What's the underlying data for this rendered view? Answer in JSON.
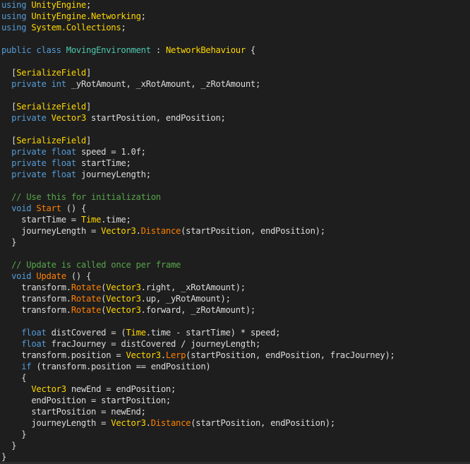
{
  "editor": {
    "theme_colors": {
      "background": "#1e1e1e",
      "keyword": "#569cd6",
      "class_name": "#4ec9b0",
      "unity_type": "#ffd700",
      "method": "#ff8000",
      "comment": "#57a64a",
      "identifier": "#dcdcdc"
    },
    "lines": [
      [
        {
          "t": "kw",
          "v": "using"
        },
        {
          "t": "id",
          "v": " "
        },
        {
          "t": "uy",
          "v": "UnityEngine"
        },
        {
          "t": "id",
          "v": ";"
        }
      ],
      [
        {
          "t": "kw",
          "v": "using"
        },
        {
          "t": "id",
          "v": " "
        },
        {
          "t": "uy",
          "v": "UnityEngine.Networking"
        },
        {
          "t": "id",
          "v": ";"
        }
      ],
      [
        {
          "t": "kw",
          "v": "using"
        },
        {
          "t": "id",
          "v": " "
        },
        {
          "t": "uy",
          "v": "System.Collections"
        },
        {
          "t": "id",
          "v": ";"
        }
      ],
      [],
      [
        {
          "t": "kw",
          "v": "public"
        },
        {
          "t": "id",
          "v": " "
        },
        {
          "t": "kw",
          "v": "class"
        },
        {
          "t": "id",
          "v": " "
        },
        {
          "t": "ty",
          "v": "MovingEnvironment"
        },
        {
          "t": "id",
          "v": " : "
        },
        {
          "t": "uy",
          "v": "NetworkBehaviour"
        },
        {
          "t": "id",
          "v": " {"
        }
      ],
      [],
      [
        {
          "t": "id",
          "v": "  ["
        },
        {
          "t": "uy",
          "v": "SerializeField"
        },
        {
          "t": "id",
          "v": "]"
        }
      ],
      [
        {
          "t": "id",
          "v": "  "
        },
        {
          "t": "kw",
          "v": "private"
        },
        {
          "t": "id",
          "v": " "
        },
        {
          "t": "kw",
          "v": "int"
        },
        {
          "t": "id",
          "v": " _yRotAmount, _xRotAmount, _zRotAmount;"
        }
      ],
      [],
      [
        {
          "t": "id",
          "v": "  ["
        },
        {
          "t": "uy",
          "v": "SerializeField"
        },
        {
          "t": "id",
          "v": "]"
        }
      ],
      [
        {
          "t": "id",
          "v": "  "
        },
        {
          "t": "kw",
          "v": "private"
        },
        {
          "t": "id",
          "v": " "
        },
        {
          "t": "uy",
          "v": "Vector3"
        },
        {
          "t": "id",
          "v": " startPosition, endPosition;"
        }
      ],
      [],
      [
        {
          "t": "id",
          "v": "  ["
        },
        {
          "t": "uy",
          "v": "SerializeField"
        },
        {
          "t": "id",
          "v": "]"
        }
      ],
      [
        {
          "t": "id",
          "v": "  "
        },
        {
          "t": "kw",
          "v": "private"
        },
        {
          "t": "id",
          "v": " "
        },
        {
          "t": "kw",
          "v": "float"
        },
        {
          "t": "id",
          "v": " speed = 1.0f;"
        }
      ],
      [
        {
          "t": "id",
          "v": "  "
        },
        {
          "t": "kw",
          "v": "private"
        },
        {
          "t": "id",
          "v": " "
        },
        {
          "t": "kw",
          "v": "float"
        },
        {
          "t": "id",
          "v": " startTime;"
        }
      ],
      [
        {
          "t": "id",
          "v": "  "
        },
        {
          "t": "kw",
          "v": "private"
        },
        {
          "t": "id",
          "v": " "
        },
        {
          "t": "kw",
          "v": "float"
        },
        {
          "t": "id",
          "v": " journeyLength;"
        }
      ],
      [],
      [
        {
          "t": "id",
          "v": "  "
        },
        {
          "t": "cm",
          "v": "// Use this for initialization"
        }
      ],
      [
        {
          "t": "id",
          "v": "  "
        },
        {
          "t": "kw",
          "v": "void"
        },
        {
          "t": "id",
          "v": " "
        },
        {
          "t": "fn",
          "v": "Start"
        },
        {
          "t": "id",
          "v": " () {"
        }
      ],
      [
        {
          "t": "id",
          "v": "    startTime = "
        },
        {
          "t": "uy",
          "v": "Time"
        },
        {
          "t": "id",
          "v": ".time;"
        }
      ],
      [
        {
          "t": "id",
          "v": "    journeyLength = "
        },
        {
          "t": "uy",
          "v": "Vector3"
        },
        {
          "t": "id",
          "v": "."
        },
        {
          "t": "fn",
          "v": "Distance"
        },
        {
          "t": "id",
          "v": "(startPosition, endPosition);"
        }
      ],
      [
        {
          "t": "id",
          "v": "  }"
        }
      ],
      [],
      [
        {
          "t": "id",
          "v": "  "
        },
        {
          "t": "cm",
          "v": "// Update is called once per frame"
        }
      ],
      [
        {
          "t": "id",
          "v": "  "
        },
        {
          "t": "kw",
          "v": "void"
        },
        {
          "t": "id",
          "v": " "
        },
        {
          "t": "fn",
          "v": "Update"
        },
        {
          "t": "id",
          "v": " () {"
        }
      ],
      [
        {
          "t": "id",
          "v": "    transform."
        },
        {
          "t": "fn",
          "v": "Rotate"
        },
        {
          "t": "id",
          "v": "("
        },
        {
          "t": "uy",
          "v": "Vector3"
        },
        {
          "t": "id",
          "v": ".right, _xRotAmount);"
        }
      ],
      [
        {
          "t": "id",
          "v": "    transform."
        },
        {
          "t": "fn",
          "v": "Rotate"
        },
        {
          "t": "id",
          "v": "("
        },
        {
          "t": "uy",
          "v": "Vector3"
        },
        {
          "t": "id",
          "v": ".up, _yRotAmount);"
        }
      ],
      [
        {
          "t": "id",
          "v": "    transform."
        },
        {
          "t": "fn",
          "v": "Rotate"
        },
        {
          "t": "id",
          "v": "("
        },
        {
          "t": "uy",
          "v": "Vector3"
        },
        {
          "t": "id",
          "v": ".forward, _zRotAmount);"
        }
      ],
      [],
      [
        {
          "t": "id",
          "v": "    "
        },
        {
          "t": "kw",
          "v": "float"
        },
        {
          "t": "id",
          "v": " distCovered = ("
        },
        {
          "t": "uy",
          "v": "Time"
        },
        {
          "t": "id",
          "v": ".time - startTime) * speed;"
        }
      ],
      [
        {
          "t": "id",
          "v": "    "
        },
        {
          "t": "kw",
          "v": "float"
        },
        {
          "t": "id",
          "v": " fracJourney = distCovered / journeyLength;"
        }
      ],
      [
        {
          "t": "id",
          "v": "    transform.position = "
        },
        {
          "t": "uy",
          "v": "Vector3"
        },
        {
          "t": "id",
          "v": "."
        },
        {
          "t": "fn",
          "v": "Lerp"
        },
        {
          "t": "id",
          "v": "(startPosition, endPosition, fracJourney);"
        }
      ],
      [
        {
          "t": "id",
          "v": "    "
        },
        {
          "t": "kw",
          "v": "if"
        },
        {
          "t": "id",
          "v": " (transform.position == endPosition)"
        }
      ],
      [
        {
          "t": "id",
          "v": "    {"
        }
      ],
      [
        {
          "t": "id",
          "v": "      "
        },
        {
          "t": "uy",
          "v": "Vector3"
        },
        {
          "t": "id",
          "v": " newEnd = endPosition;"
        }
      ],
      [
        {
          "t": "id",
          "v": "      endPosition = startPosition;"
        }
      ],
      [
        {
          "t": "id",
          "v": "      startPosition = newEnd;"
        }
      ],
      [
        {
          "t": "id",
          "v": "      journeyLength = "
        },
        {
          "t": "uy",
          "v": "Vector3"
        },
        {
          "t": "id",
          "v": "."
        },
        {
          "t": "fn",
          "v": "Distance"
        },
        {
          "t": "id",
          "v": "(startPosition, endPosition);"
        }
      ],
      [
        {
          "t": "id",
          "v": "    }"
        }
      ],
      [
        {
          "t": "id",
          "v": "  }"
        }
      ],
      [
        {
          "t": "id",
          "v": "}"
        }
      ]
    ]
  }
}
